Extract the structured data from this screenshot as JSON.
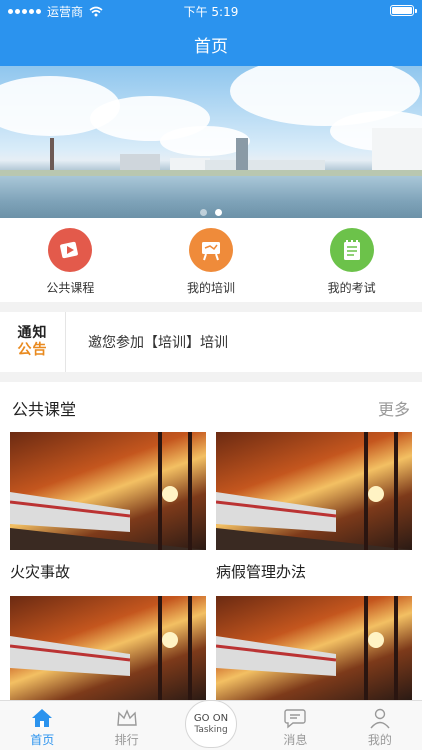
{
  "status_bar": {
    "carrier": "运营商",
    "time": "下午 5:19"
  },
  "nav": {
    "title": "首页"
  },
  "banner": {
    "pages": 2,
    "active_page": 2
  },
  "quick_actions": [
    {
      "label": "公共课程",
      "icon": "play-course-icon",
      "color": "#e35a4b"
    },
    {
      "label": "我的培训",
      "icon": "easel-training-icon",
      "color": "#ef8b3a"
    },
    {
      "label": "我的考试",
      "icon": "notepad-exam-icon",
      "color": "#6cc24a"
    }
  ],
  "notice": {
    "logo_top": "通知",
    "logo_bottom": "公告",
    "text": "邀您参加【培训】培训"
  },
  "public_class": {
    "title": "公共课堂",
    "more": "更多",
    "courses": [
      {
        "title": "火灾事故"
      },
      {
        "title": "病假管理办法"
      },
      {
        "title": ""
      },
      {
        "title": ""
      }
    ]
  },
  "tabbar": {
    "tabs": [
      {
        "label": "首页",
        "icon": "home-icon",
        "active": true
      },
      {
        "label": "排行",
        "icon": "crown-icon",
        "active": false
      },
      {
        "label": "",
        "icon": "",
        "active": false
      },
      {
        "label": "消息",
        "icon": "message-icon",
        "active": false
      },
      {
        "label": "我的",
        "icon": "profile-icon",
        "active": false
      }
    ],
    "center_line1": "GO ON",
    "center_line2": "Tasking"
  },
  "colors": {
    "primary": "#2b93ee",
    "notice_accent": "#e98a1f"
  }
}
